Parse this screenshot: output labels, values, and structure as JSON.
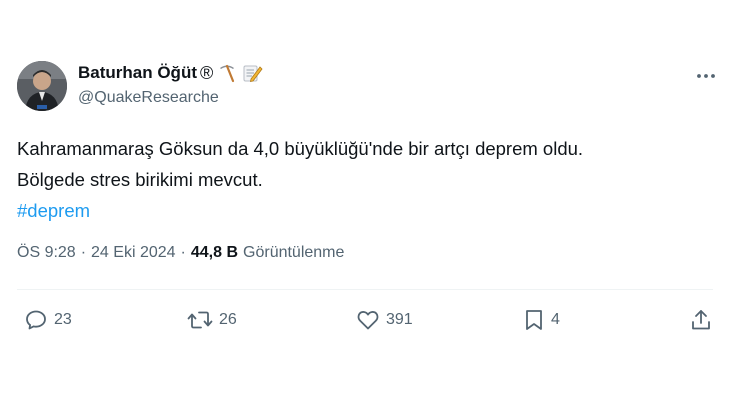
{
  "author": {
    "display_name": "Baturhan Öğüt",
    "registered_mark": "®",
    "handle": "@QuakeResearche",
    "avatar_icon": "avatar-photo",
    "emoji_icons": [
      "pick-icon",
      "memo-icon"
    ]
  },
  "more_icon": "more-horizontal-icon",
  "tweet": {
    "line1": "Kahramanmaraş Göksun da 4,0 büyüklüğü'nde bir artçı deprem oldu.",
    "line2": "Bölgede stres birikimi mevcut.",
    "hashtag": "#deprem"
  },
  "meta": {
    "time": "ÖS 9:28",
    "separator": "·",
    "date": "24 Eki 2024",
    "views_count": "44,8 B",
    "views_label": "Görüntülenme"
  },
  "actions": {
    "reply": {
      "icon": "reply-icon",
      "count": "23"
    },
    "retweet": {
      "icon": "retweet-icon",
      "count": "26"
    },
    "like": {
      "icon": "heart-icon",
      "count": "391"
    },
    "bookmark": {
      "icon": "bookmark-icon",
      "count": "4"
    },
    "share": {
      "icon": "share-icon"
    }
  },
  "colors": {
    "text": "#0f1419",
    "secondary": "#536471",
    "link": "#1d9bf0",
    "divider": "#eff3f4"
  }
}
